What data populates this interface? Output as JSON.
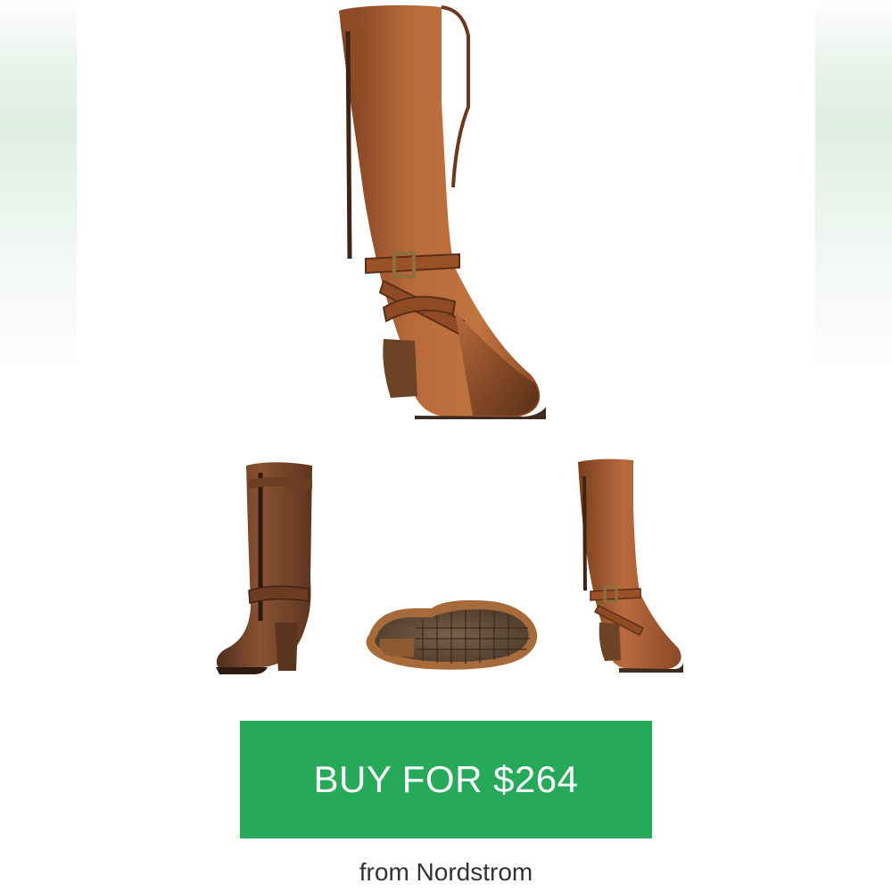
{
  "colors": {
    "buy_button": "#27a95a",
    "buy_text": "#ffffff",
    "leather": "#a4582d",
    "leather_dark": "#6a371d",
    "heel": "#6c4325",
    "sole": "#5f4a39"
  },
  "product": {
    "images": [
      {
        "name": "main-boot-image",
        "view": "side"
      },
      {
        "name": "back-boot-image",
        "view": "back"
      },
      {
        "name": "sole-boot-image",
        "view": "sole"
      },
      {
        "name": "side-boot-image",
        "view": "side"
      }
    ]
  },
  "purchase": {
    "button_label": "BUY FOR $264",
    "source": "from Nordstrom"
  }
}
